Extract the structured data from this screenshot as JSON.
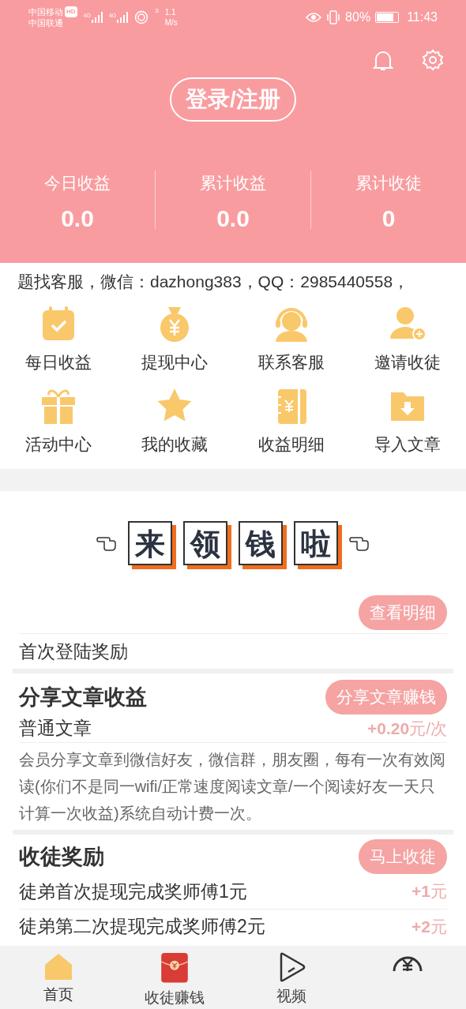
{
  "status_bar": {
    "carrier_1": "中国移动",
    "hd": "HD",
    "carrier_2": "中国联通",
    "net_1": "4G",
    "net_2": "4G",
    "wifi_num": "3",
    "speed": "1.1",
    "speed_unit": "M/s",
    "battery": "80%",
    "time": "11:43"
  },
  "header": {
    "login_button": "登录/注册",
    "stats": [
      {
        "label": "今日收益",
        "value": "0.0"
      },
      {
        "label": "累计收益",
        "value": "0.0"
      },
      {
        "label": "累计收徒",
        "value": "0"
      }
    ]
  },
  "ticker": "题找客服，微信：dazhong383，QQ：2985440558，",
  "menu": [
    {
      "label": "每日收益",
      "kind": "calendar"
    },
    {
      "label": "提现中心",
      "kind": "moneybag"
    },
    {
      "label": "联系客服",
      "kind": "headset"
    },
    {
      "label": "邀请收徒",
      "kind": "adduser"
    },
    {
      "label": "活动中心",
      "kind": "gift"
    },
    {
      "label": "我的收藏",
      "kind": "star"
    },
    {
      "label": "收益明细",
      "kind": "ledger"
    },
    {
      "label": "导入文章",
      "kind": "folder"
    }
  ],
  "banner": {
    "chars": [
      "来",
      "领",
      "钱",
      "啦"
    ]
  },
  "first_login": {
    "button": "查看明细",
    "title": "首次登陆奖励"
  },
  "share": {
    "title": "分享文章收益",
    "button": "分享文章赚钱",
    "item": "普通文章",
    "amount": "+0.20",
    "unit": "元/次",
    "description": "会员分享文章到微信好友，微信群，朋友圈，每有一次有效阅读(你们不是同一wifi/正常速度阅读文章/一个阅读好友一天只计算一次收益)系统自动计费一次。"
  },
  "apprentice": {
    "title": "收徒奖励",
    "button": "马上收徒",
    "rows": [
      {
        "label": "徒弟首次提现完成奖师傅1元",
        "amount": "+1",
        "unit": "元"
      },
      {
        "label": "徒弟第二次提现完成奖师傅2元",
        "amount": "+2",
        "unit": "元"
      }
    ]
  },
  "tabs": [
    {
      "label": "首页",
      "kind": "home",
      "selected": true
    },
    {
      "label": "收徒赚钱",
      "kind": "envelope",
      "selected": false
    },
    {
      "label": "视频",
      "kind": "play",
      "selected": false
    },
    {
      "kind": "yen",
      "selected": false
    }
  ]
}
